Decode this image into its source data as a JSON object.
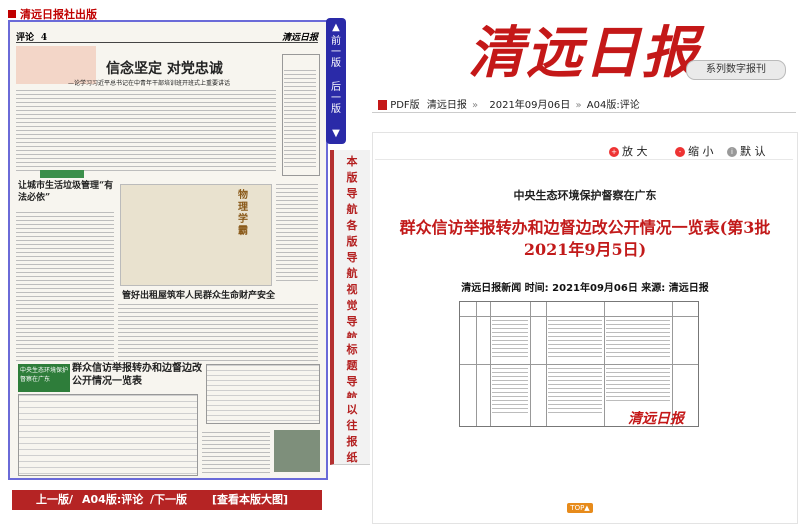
{
  "publisher_label": "清远日报社出版",
  "page_preview": {
    "section_label": "评论",
    "page_no": "4",
    "masthead_small": "清远日报",
    "headline_main": "信念坚定  对党忠诚",
    "headline_sub": "—论学习习近平总书记在中青年干部培训班开班式上重要讲话",
    "left_story_title": "让城市生活垃圾管理“有法必依”",
    "mid_story_title": "管好出租屋筑牢人民群众生命财产安全",
    "bottom_story_title": "群众信访举报转办和边督边改公开情况一览表",
    "side_tag": "中央生态环境保护督察在广东",
    "cartoon_caption": "物理学霸"
  },
  "side_tabs": {
    "prev": "前一版",
    "next": "后一版"
  },
  "nav_items": [
    "本版导航",
    "各版导航",
    "视觉导航",
    "标题导航",
    "以往报纸"
  ],
  "bottom_bar": {
    "prev_link": "上一版/",
    "current": "A04版:评论",
    "next_link": "/下一版",
    "view_big": "[查看本版大图]"
  },
  "logo": {
    "text": "清远日报",
    "sub": "系列数字报刊"
  },
  "breadcrumb": {
    "pdf": "PDF版",
    "paper": "清远日报",
    "date": "2021年09月06日",
    "page": "A04版:评论"
  },
  "toolbar": {
    "zoom_in": "放 大",
    "zoom_out": "缩 小",
    "default": "默 认"
  },
  "article": {
    "subtitle": "中央生态环境保护督察在广东",
    "headline": "群众信访举报转办和边督边改公开情况一览表(第3批2021年9月5日)",
    "source_line": "清远日报新闻  时间:  2021年09月06日  来源:  清远日报",
    "watermark": "清远日报",
    "top_button": "TOP▲"
  },
  "colors": {
    "brand_red": "#c41818",
    "nav_blue": "#2a2aa8",
    "bar_red": "#b52424",
    "top_orange": "#e78b1b"
  }
}
